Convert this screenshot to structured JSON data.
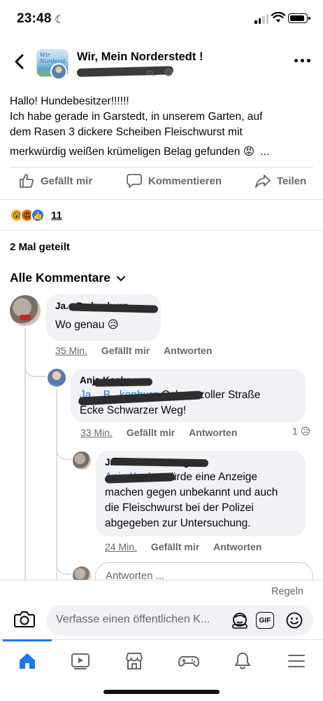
{
  "status_bar": {
    "time": "23:48"
  },
  "header": {
    "group_name": "Wir, Mein Norderstedt !",
    "group_logo_text": "Wir Norderst.",
    "time_suffix": "...m. ·"
  },
  "post": {
    "lines": [
      "Hallo! Hundebesitzer!!!!!!",
      "Ich habe gerade in Garstedt,  in unserem  Garten,  auf",
      "dem Rasen 3 dickere Scheiben Fleischwurst mit",
      "merkwürdig weißen krümeligen Belag gefunden"
    ],
    "line4_emoji": "😡",
    "more": "..."
  },
  "actions": {
    "like": "Gefällt mir",
    "comment": "Kommentieren",
    "share": "Teilen"
  },
  "reactions": {
    "emojis": [
      "😮",
      "😡",
      "👍"
    ],
    "count": "11"
  },
  "shares": "2 Mal geteilt",
  "sort_label": "Alle Kommentare",
  "comments": [
    {
      "author": "Ja... B...kenburg",
      "text": "Wo genau 😥",
      "time": "35 Min.",
      "like": "Gefällt mir",
      "reply": "Antworten"
    },
    {
      "author": "Anja Koska",
      "mention": "Ja... B...kenburg",
      "text1": " Ochsenzoller Straße",
      "text2": "Ecke Schwarzer Weg!",
      "time": "33 Min.",
      "like": "Gefällt mir",
      "reply": "Antworten",
      "reaction_count": "1",
      "reaction_emoji": "😥"
    },
    {
      "author": "Janine B...kenburg",
      "mention": "Anja Koska",
      "text1": " würde eine Anzeige",
      "text2": "machen gegen unbekannt und auch",
      "text3": "die Fleischwurst bei der Polizei",
      "text4": "abgegeben zur Untersuchung.",
      "time": "24 Min.",
      "like": "Gefällt mir",
      "reply": "Antworten"
    }
  ],
  "reply_placeholder": "Antworten ...",
  "composer": {
    "rules": "Regeln",
    "placeholder": "Verfasse einen öffentlichen K...",
    "gif": "GIF"
  },
  "tabs": [
    "home-icon",
    "video-icon",
    "marketplace-icon",
    "gaming-icon",
    "bell-icon",
    "menu-icon"
  ],
  "colors": {
    "accent": "#1877f2",
    "secondary_text": "#65676b",
    "bubble": "#f0f2f5"
  }
}
